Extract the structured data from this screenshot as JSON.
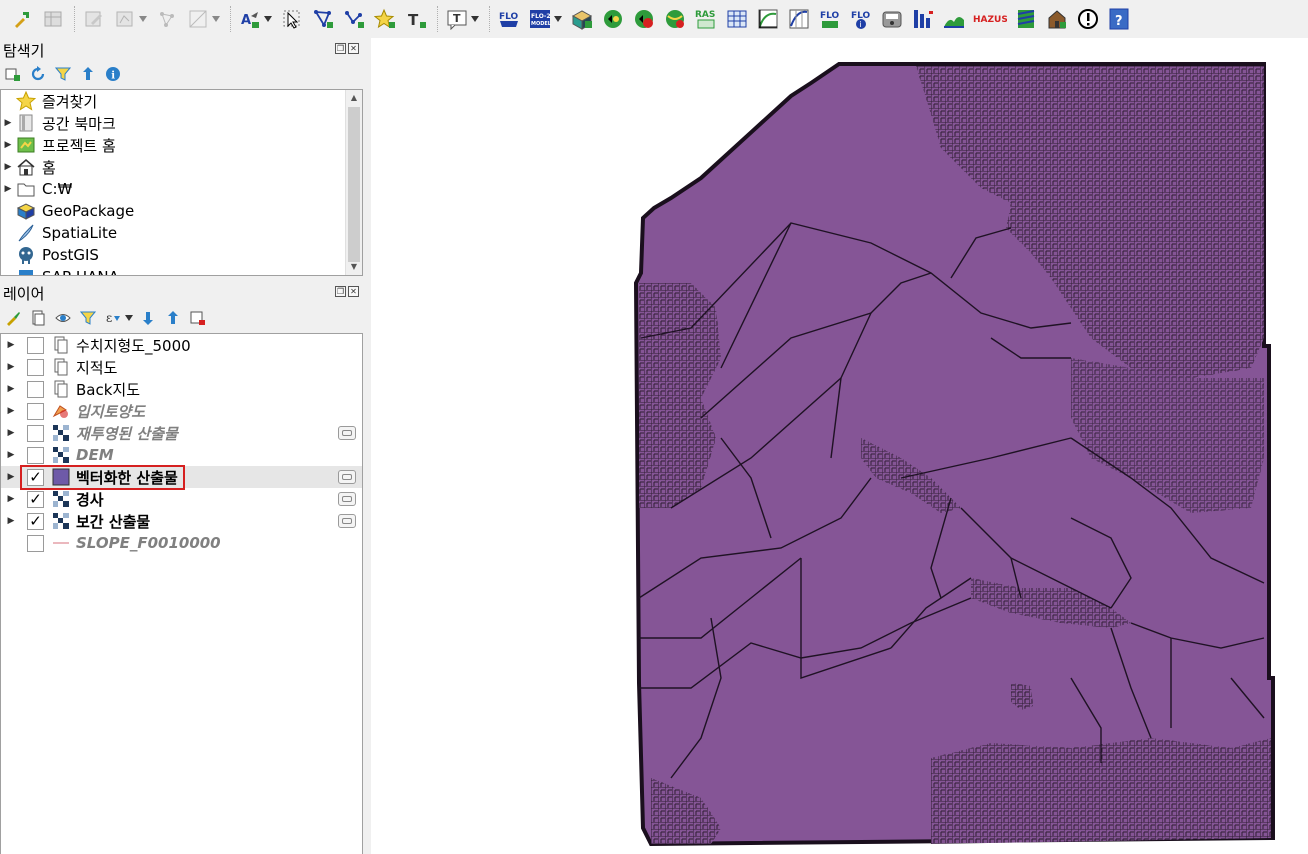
{
  "toolbar": {
    "icons": [
      "identify-features-icon",
      "attribute-table-icon",
      "toggle-editing-icon",
      "digitize-icon",
      "vertex-tool-icon",
      "digitize-advanced-icon",
      "new-annotation-icon",
      "select-features-icon",
      "add-polygon-icon",
      "add-line-icon",
      "add-point-icon",
      "add-text-icon",
      "text-annotation-icon",
      "flo2d-icon",
      "flo2d-model-icon",
      "flo2d-grid-icon",
      "flo2d-green-icon",
      "flo2d-red-icon",
      "flo2d-globe-icon",
      "ras-icon",
      "grid-table-icon",
      "profile-icon",
      "cross-section-icon",
      "flo-run-icon",
      "flo-info-icon",
      "flo-disk-icon",
      "hydrograph-icon",
      "terrain-icon",
      "hazus-icon",
      "stripes-icon",
      "building-icon",
      "warning-icon",
      "help-icon"
    ],
    "ras_label": "RAS",
    "hazus_label": "HAZUS",
    "flo_label": "FLO",
    "flo2d_model_label": "FLO-2D MODEL"
  },
  "browser_panel": {
    "title": "탐색기",
    "items": [
      {
        "label": "즐겨찾기",
        "icon": "star-icon",
        "expandable": false
      },
      {
        "label": "공간 북마크",
        "icon": "bookmark-icon",
        "expandable": true
      },
      {
        "label": "프로젝트 홈",
        "icon": "project-home-icon",
        "expandable": true
      },
      {
        "label": "홈",
        "icon": "home-icon",
        "expandable": true
      },
      {
        "label": "C:₩",
        "icon": "folder-icon",
        "expandable": true
      },
      {
        "label": "GeoPackage",
        "icon": "geopackage-icon",
        "expandable": false
      },
      {
        "label": "SpatiaLite",
        "icon": "spatialite-icon",
        "expandable": false
      },
      {
        "label": "PostGIS",
        "icon": "postgis-icon",
        "expandable": false
      },
      {
        "label": "SAP HANA",
        "icon": "hana-icon",
        "expandable": false
      }
    ]
  },
  "layers_panel": {
    "title": "레이어",
    "layers": [
      {
        "label": "수치지형도_5000",
        "checked": false,
        "style": "normal",
        "icon": "group-icon",
        "indicator": false
      },
      {
        "label": "지적도",
        "checked": false,
        "style": "normal",
        "icon": "group-icon",
        "indicator": false
      },
      {
        "label": "Back지도",
        "checked": false,
        "style": "normal",
        "icon": "group-icon",
        "indicator": false
      },
      {
        "label": "입지토양도",
        "checked": false,
        "style": "italic",
        "icon": "mesh-icon",
        "indicator": false
      },
      {
        "label": "재투영된 산출물",
        "checked": false,
        "style": "italic",
        "icon": "raster-icon",
        "indicator": true
      },
      {
        "label": "DEM",
        "checked": false,
        "style": "italic",
        "icon": "raster-icon",
        "indicator": false
      },
      {
        "label": "벡터화한 산출물",
        "checked": true,
        "style": "bold",
        "icon": "polygon-fill-icon",
        "indicator": true,
        "selected": true
      },
      {
        "label": "경사",
        "checked": true,
        "style": "bold",
        "icon": "raster-icon",
        "indicator": true
      },
      {
        "label": "보간 산출물",
        "checked": true,
        "style": "bold",
        "icon": "raster-icon",
        "indicator": true
      },
      {
        "label": "SLOPE_F0010000",
        "checked": false,
        "style": "italic",
        "icon": "line-icon",
        "indicator": false
      }
    ],
    "check_mark": "✓"
  },
  "map": {
    "fill_color": "#855596",
    "stroke_color": "#2a1a2e"
  },
  "colors": {
    "accent_red": "#d62020",
    "flo_blue": "#1f3fa6",
    "green": "#2e9b3b"
  }
}
